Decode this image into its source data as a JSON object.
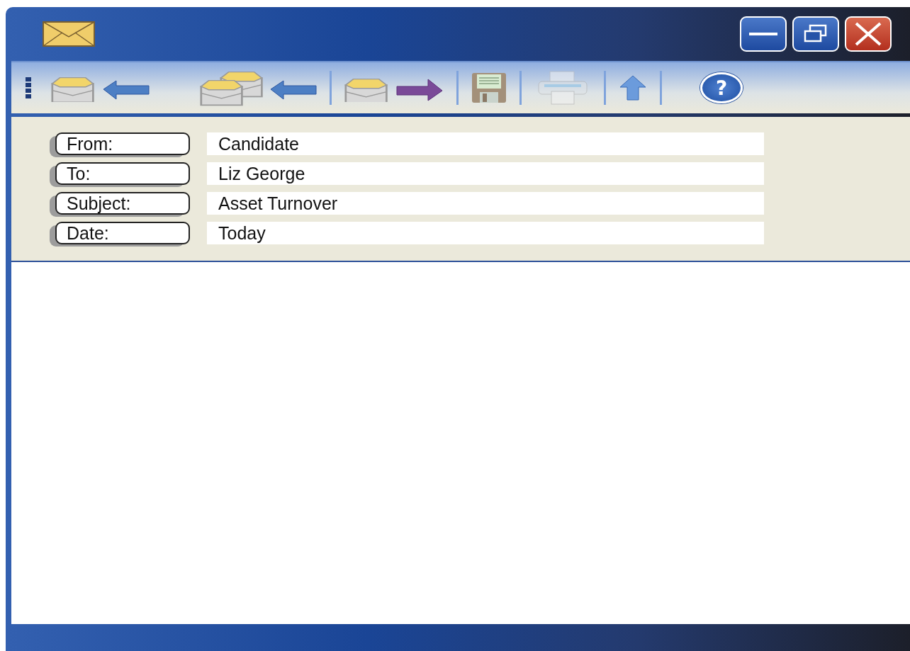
{
  "toolbar": [
    {
      "kind": "reply",
      "disabled": false
    },
    {
      "kind": "reply-all",
      "disabled": false
    },
    {
      "kind": "forward",
      "disabled": false
    },
    {
      "kind": "save",
      "disabled": false
    },
    {
      "kind": "print",
      "disabled": true
    },
    {
      "kind": "up",
      "disabled": false
    },
    {
      "kind": "help",
      "label": "?",
      "disabled": false
    }
  ],
  "header_fields": [
    {
      "label": "From:",
      "value": "Candidate"
    },
    {
      "label": "To:",
      "value": "Liz George"
    },
    {
      "label": "Subject:",
      "value": "Asset Turnover"
    },
    {
      "label": "Date:",
      "value": "Today"
    }
  ]
}
